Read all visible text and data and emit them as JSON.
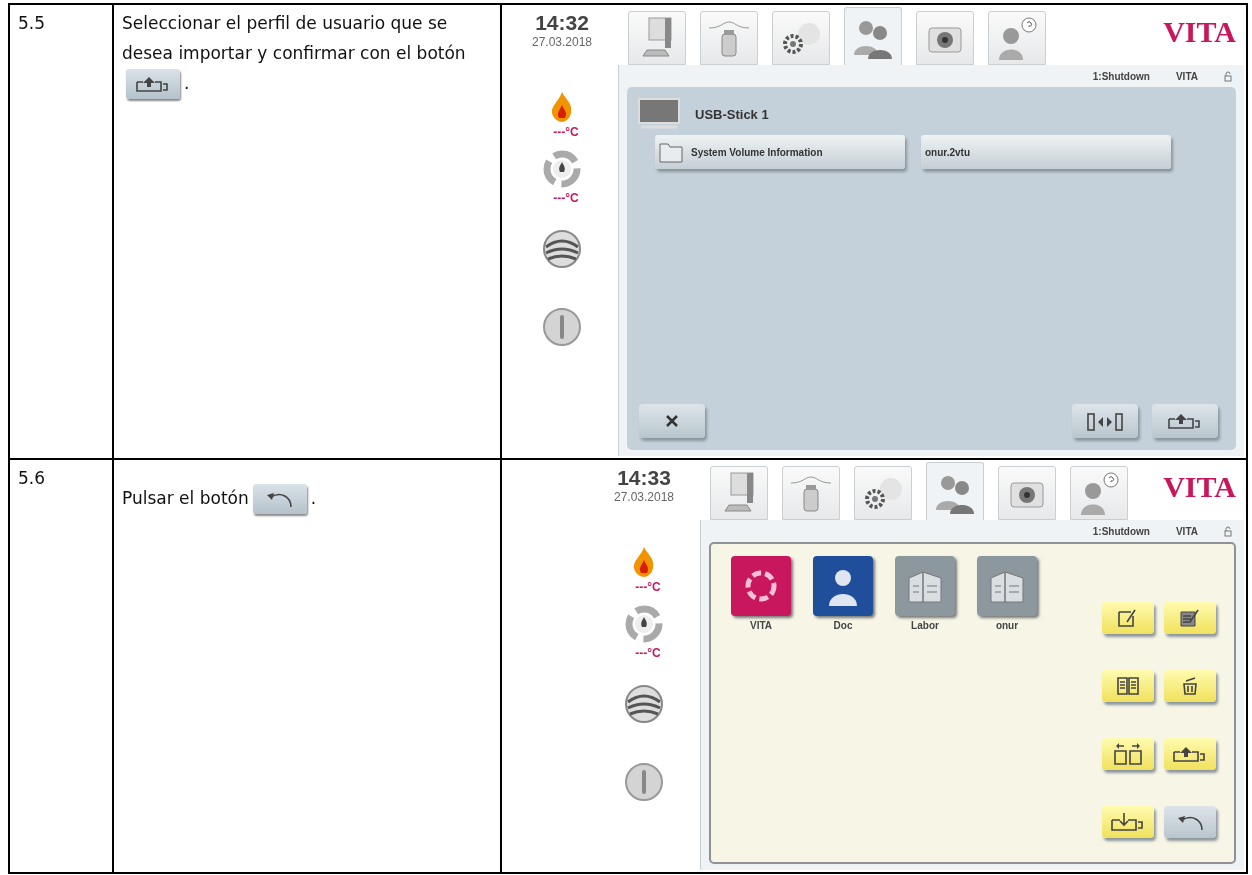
{
  "steps": [
    {
      "number": "5.5",
      "instruction": {
        "text_before": "Seleccionar el perfil de usuario que se desea importar y confirmar con el botón",
        "kind": "upload",
        "text_after": "."
      },
      "screen": {
        "time": "14:32",
        "date": "27.03.2018",
        "logo": "VITA",
        "tabs": [
          {
            "kind": "furnace",
            "selected": false
          },
          {
            "kind": "vial",
            "selected": false
          },
          {
            "kind": "gear",
            "selected": false
          },
          {
            "kind": "people",
            "selected": true
          },
          {
            "kind": "camera",
            "selected": false
          },
          {
            "kind": "help",
            "selected": false
          }
        ],
        "status": {
          "program": "1:Shutdown",
          "user": "VITA"
        },
        "readings": [
          "---°C",
          "---°C"
        ],
        "content": {
          "kind": "file_browser",
          "drive": "USB-Stick 1",
          "entries": [
            {
              "kind": "folder",
              "name": "System Volume Information"
            },
            {
              "kind": "file",
              "name": "onur.2vtu"
            }
          ],
          "left_buttons": [
            {
              "kind": "close"
            }
          ],
          "right_buttons": [
            {
              "kind": "swap"
            },
            {
              "kind": "upload"
            }
          ]
        }
      }
    },
    {
      "number": "5.6",
      "instruction": {
        "text_before": "Pulsar el botón",
        "kind": "undo",
        "text_after": "."
      },
      "screen": {
        "time": "14:33",
        "date": "27.03.2018",
        "logo": "VITA",
        "tabs": [
          {
            "kind": "furnace",
            "selected": false
          },
          {
            "kind": "vial",
            "selected": false
          },
          {
            "kind": "gear",
            "selected": false
          },
          {
            "kind": "people",
            "selected": true
          },
          {
            "kind": "camera",
            "selected": false
          },
          {
            "kind": "help",
            "selected": false
          }
        ],
        "status": {
          "program": "1:Shutdown",
          "user": "VITA"
        },
        "readings": [
          "---°C",
          "---°C"
        ],
        "content": {
          "kind": "profiles",
          "profiles": [
            {
              "name": "VITA",
              "kind": "ring",
              "color": "#c8175d"
            },
            {
              "name": "Doc",
              "kind": "person",
              "color": "#1f4f9a"
            },
            {
              "name": "Labor",
              "kind": "building",
              "color": "#8c989e"
            },
            {
              "name": "onur",
              "kind": "building",
              "color": "#8c989e"
            }
          ],
          "actions": [
            {
              "kind": "edit"
            },
            {
              "kind": "edit_text"
            },
            {
              "kind": "copy"
            },
            {
              "kind": "delete"
            },
            {
              "kind": "swap_cards"
            },
            {
              "kind": "upload"
            },
            {
              "kind": "download"
            },
            {
              "kind": "undo"
            }
          ]
        }
      }
    }
  ]
}
